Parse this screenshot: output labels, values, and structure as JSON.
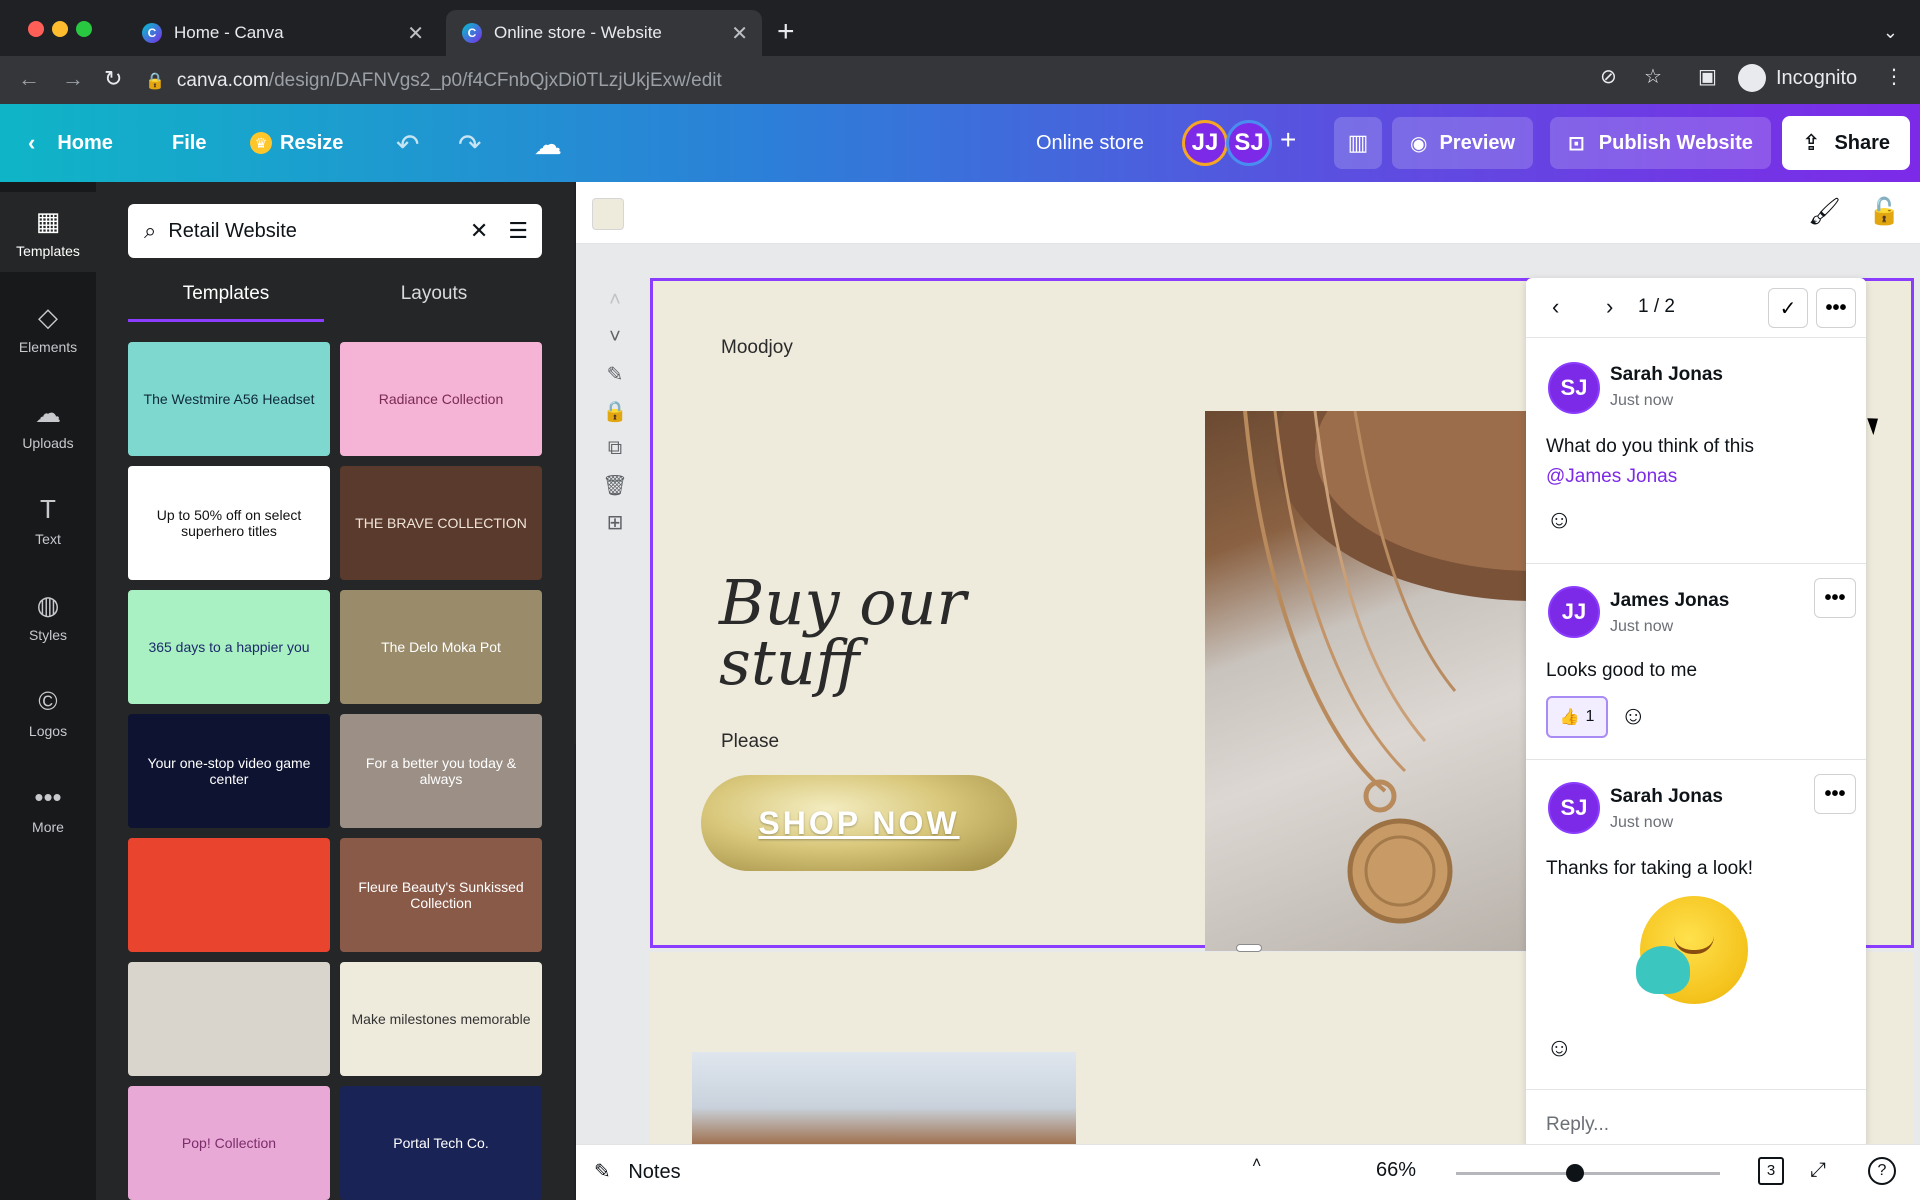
{
  "browser": {
    "tabs": [
      {
        "title": "Home - Canva",
        "active": false
      },
      {
        "title": "Online store - Website",
        "active": true
      }
    ],
    "url_host": "canva.com",
    "url_path": "/design/DAFNVgs2_p0/f4CFnbQjxDi0TLzjUkjExw/edit",
    "incognito_label": "Incognito"
  },
  "header": {
    "home": "Home",
    "file": "File",
    "resize": "Resize",
    "title": "Online store",
    "avatars": [
      "JJ",
      "SJ"
    ],
    "preview": "Preview",
    "publish": "Publish Website",
    "share": "Share"
  },
  "rail": {
    "items": [
      {
        "label": "Templates",
        "icon": "templates-icon"
      },
      {
        "label": "Elements",
        "icon": "elements-icon"
      },
      {
        "label": "Uploads",
        "icon": "uploads-icon"
      },
      {
        "label": "Text",
        "icon": "text-icon"
      },
      {
        "label": "Styles",
        "icon": "styles-icon"
      },
      {
        "label": "Logos",
        "icon": "logos-icon"
      },
      {
        "label": "More",
        "icon": "more-icon"
      }
    ]
  },
  "panel": {
    "search_value": "Retail Website",
    "tabs": [
      "Templates",
      "Layouts"
    ],
    "thumbnails": [
      {
        "text": "The Westmire A56 Headset",
        "bg": "#7fd8d0",
        "fg": "#0e2a3a"
      },
      {
        "text": "Radiance Collection",
        "bg": "#f5b3d5",
        "fg": "#7a2b55"
      },
      {
        "text": "Up to 50% off on select superhero titles",
        "bg": "#ffffff",
        "fg": "#111111"
      },
      {
        "text": "THE BRAVE COLLECTION",
        "bg": "#5a3a2c",
        "fg": "#f0e4d8"
      },
      {
        "text": "365 days to a happier you",
        "bg": "#a9f0c3",
        "fg": "#1c2b6b"
      },
      {
        "text": "The Delo Moka Pot",
        "bg": "#9a8b6a",
        "fg": "#ffffff"
      },
      {
        "text": "Your one-stop video game center",
        "bg": "#0d1330",
        "fg": "#ffffff"
      },
      {
        "text": "For a better you today & always",
        "bg": "#9b8f86",
        "fg": "#ffffff"
      },
      {
        "text": "",
        "bg": "#e8442e",
        "fg": "#ffffff"
      },
      {
        "text": "Fleure Beauty's Sunkissed Collection",
        "bg": "#8a5a48",
        "fg": "#ffffff"
      },
      {
        "text": "",
        "bg": "#d9d4cc",
        "fg": "#333333"
      },
      {
        "text": "Make milestones memorable",
        "bg": "#eeebdd",
        "fg": "#333333"
      },
      {
        "text": "Pop! Collection",
        "bg": "#e9a9d6",
        "fg": "#7b2d6a"
      },
      {
        "text": "Portal Tech Co.",
        "bg": "#1a2356",
        "fg": "#ffffff"
      }
    ]
  },
  "canvas": {
    "brand": "Moodjoy",
    "headline": "Buy our stuff",
    "subtext": "Please",
    "cta": "SHOP NOW"
  },
  "comments": {
    "pager": "1 / 2",
    "items": [
      {
        "initials": "SJ",
        "name": "Sarah Jonas",
        "time": "Just now",
        "text": "What do you think of this",
        "mention": "@James Jonas"
      },
      {
        "initials": "JJ",
        "name": "James Jonas",
        "time": "Just now",
        "text": "Looks good to me",
        "reaction": "👍",
        "reaction_count": "1"
      },
      {
        "initials": "SJ",
        "name": "Sarah Jonas",
        "time": "Just now",
        "text": "Thanks for taking a look!"
      }
    ],
    "reply_placeholder": "Reply..."
  },
  "bottombar": {
    "notes": "Notes",
    "zoom": "66%",
    "zoom_fraction": 0.45,
    "page_count": "3"
  },
  "colors": {
    "accent": "#8b3dff",
    "page_bg": "#eeebdd"
  }
}
